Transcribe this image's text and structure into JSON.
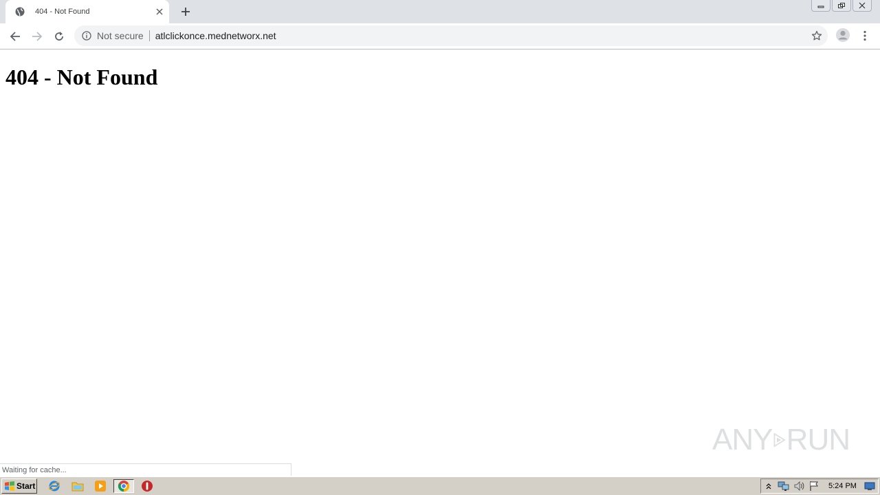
{
  "browser": {
    "tab": {
      "title": "404 - Not Found",
      "favicon": "globe-icon"
    },
    "new_tab_icon": "plus-icon",
    "window_controls": [
      "minimize-icon",
      "restore-icon",
      "close-icon"
    ],
    "omnibox": {
      "security_label": "Not secure",
      "url": "atlclickonce.mednetworx.net"
    },
    "toolbar_icons": [
      "back-icon",
      "forward-icon",
      "reload-icon",
      "info-icon",
      "star-icon",
      "profile-icon",
      "menu-icon"
    ]
  },
  "page": {
    "heading": "404 - Not Found"
  },
  "status_bar": {
    "text": "Waiting for cache..."
  },
  "watermark": {
    "left": "ANY",
    "right": "RUN"
  },
  "taskbar": {
    "start_label": "Start",
    "apps": [
      "ie-icon",
      "explorer-icon",
      "media-player-icon",
      "chrome-icon",
      "stop-icon"
    ],
    "tray_icons": [
      "chevron-up-icon",
      "network-icon",
      "volume-icon",
      "flag-icon"
    ],
    "clock": "5:24 PM"
  },
  "colors": {
    "tab_strip": "#dee1e6",
    "omnibox": "#f1f3f4",
    "taskbar": "#d4d0c8"
  }
}
